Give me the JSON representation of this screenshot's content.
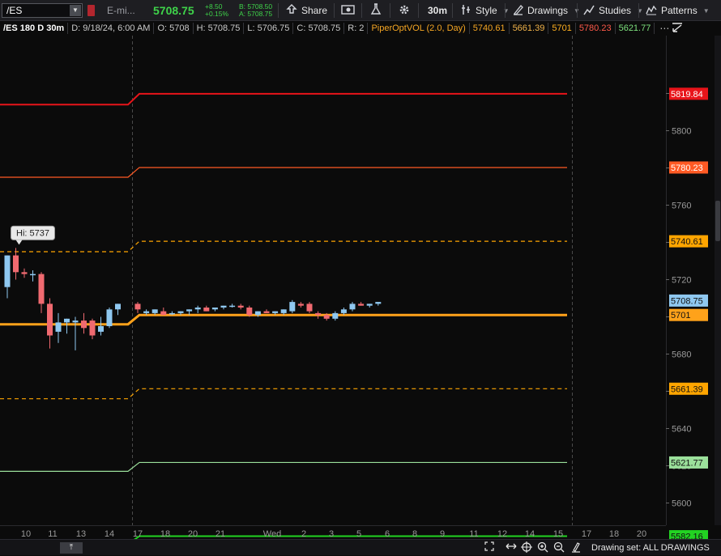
{
  "toolbar": {
    "symbol": "/ES",
    "instrument": "E-mi...",
    "last_price": "5708.75",
    "net_change": "+8.50",
    "net_change_pct": "+0.15%",
    "bid": "B: 5708.50",
    "ask": "A: 5708.75",
    "share_label": "Share",
    "timeframe_label": "30m",
    "style_label": "Style",
    "drawings_label": "Drawings",
    "studies_label": "Studies",
    "patterns_label": "Patterns",
    "icons": [
      "share-icon",
      "snapshot-icon",
      "flask-icon",
      "gear-icon",
      "style-icon",
      "drawings-icon",
      "studies-icon",
      "patterns-icon"
    ]
  },
  "header": {
    "title": "/ES 180 D 30m",
    "date": "D: 9/18/24, 6:00 AM",
    "open": "O: 5708",
    "high": "H: 5708.75",
    "low": "L: 5706.75",
    "close": "C: 5708.75",
    "range": "R: 2",
    "study_name": "PiperOptVOL (2.0, Day)",
    "study_values": [
      "5740.61",
      "5661.39",
      "5701",
      "5780.23",
      "5621.77"
    ],
    "menu_glyph": "⋯"
  },
  "chart_data": {
    "type": "candlestick",
    "y_range": [
      5570,
      5830
    ],
    "y_ticks": [
      5580,
      5600,
      5620,
      5640,
      5660,
      5680,
      5700,
      5720,
      5740,
      5760,
      5780,
      5800,
      5820
    ],
    "x_labels": [
      "10",
      "11",
      "13",
      "14",
      "17",
      "18",
      "20",
      "21",
      "Wed",
      "2",
      "3",
      "5",
      "6",
      "8",
      "9",
      "11",
      "12",
      "14",
      "15",
      "17",
      "18",
      "20"
    ],
    "session_divider_label": "17",
    "high_annotation": "Hi: 5737",
    "levels": [
      {
        "name": "upper-band-2",
        "color": "#e8141a",
        "style": "solid",
        "prev": 5814,
        "current": 5819.84,
        "label": "5819.84"
      },
      {
        "name": "upper-band-1",
        "color": "#ff5a24",
        "style": "solid",
        "prev": 5775,
        "current": 5780.23,
        "label": "5780.23"
      },
      {
        "name": "upper-dashed",
        "color": "#ffa500",
        "style": "dashed",
        "prev": 5735,
        "current": 5740.61,
        "label": "5740.61"
      },
      {
        "name": "mid-line",
        "color": "#ffa21a",
        "style": "thick",
        "prev": 5696,
        "current": 5701,
        "label": "5701"
      },
      {
        "name": "lower-dashed",
        "color": "#ffa500",
        "style": "dashed",
        "prev": 5656,
        "current": 5661.39,
        "label": "5661.39"
      },
      {
        "name": "lower-band-1",
        "color": "#9be09b",
        "style": "solid",
        "prev": 5617,
        "current": 5621.77,
        "label": "5621.77"
      },
      {
        "name": "lower-band-2",
        "color": "#22d322",
        "style": "solid",
        "prev": 5578,
        "current": 5582.16,
        "label": "5582.16"
      }
    ],
    "last_price_label": "5708.75",
    "candles": [
      {
        "o": 5716,
        "h": 5726,
        "l": 5710,
        "c": 5733
      },
      {
        "o": 5733,
        "h": 5737,
        "l": 5720,
        "c": 5724
      },
      {
        "o": 5724,
        "h": 5726,
        "l": 5721,
        "c": 5723
      },
      {
        "o": 5723,
        "h": 5725,
        "l": 5719,
        "c": 5723
      },
      {
        "o": 5723,
        "h": 5724,
        "l": 5702,
        "c": 5707
      },
      {
        "o": 5707,
        "h": 5710,
        "l": 5683,
        "c": 5690
      },
      {
        "o": 5692,
        "h": 5702,
        "l": 5686,
        "c": 5697
      },
      {
        "o": 5697,
        "h": 5699,
        "l": 5691,
        "c": 5699
      },
      {
        "o": 5697,
        "h": 5700,
        "l": 5682,
        "c": 5698
      },
      {
        "o": 5698,
        "h": 5702,
        "l": 5691,
        "c": 5694
      },
      {
        "o": 5698,
        "h": 5699,
        "l": 5688,
        "c": 5690
      },
      {
        "o": 5692,
        "h": 5700,
        "l": 5690,
        "c": 5695
      },
      {
        "o": 5695,
        "h": 5705,
        "l": 5694,
        "c": 5704
      },
      {
        "o": 5704,
        "h": 5707,
        "l": 5701,
        "c": 5707
      },
      {
        "o": 5707,
        "h": 5708,
        "l": 5702,
        "c": 5704
      },
      {
        "o": 5702,
        "h": 5704,
        "l": 5701,
        "c": 5703
      },
      {
        "o": 5702,
        "h": 5704,
        "l": 5701,
        "c": 5704
      },
      {
        "o": 5703,
        "h": 5705,
        "l": 5701,
        "c": 5701
      },
      {
        "o": 5702,
        "h": 5703,
        "l": 5701,
        "c": 5702
      },
      {
        "o": 5702,
        "h": 5703,
        "l": 5701,
        "c": 5703
      },
      {
        "o": 5703,
        "h": 5704,
        "l": 5701,
        "c": 5704
      },
      {
        "o": 5704,
        "h": 5706,
        "l": 5702,
        "c": 5705
      },
      {
        "o": 5705,
        "h": 5706,
        "l": 5703,
        "c": 5703
      },
      {
        "o": 5704,
        "h": 5705,
        "l": 5703,
        "c": 5705
      },
      {
        "o": 5705,
        "h": 5706,
        "l": 5704,
        "c": 5706
      },
      {
        "o": 5706,
        "h": 5707,
        "l": 5705,
        "c": 5706
      },
      {
        "o": 5706,
        "h": 5707,
        "l": 5704,
        "c": 5705
      },
      {
        "o": 5705,
        "h": 5706,
        "l": 5700,
        "c": 5701
      },
      {
        "o": 5701,
        "h": 5703,
        "l": 5700,
        "c": 5703
      },
      {
        "o": 5703,
        "h": 5704,
        "l": 5702,
        "c": 5702
      },
      {
        "o": 5702,
        "h": 5703,
        "l": 5701,
        "c": 5703
      },
      {
        "o": 5702,
        "h": 5704,
        "l": 5701,
        "c": 5704
      },
      {
        "o": 5703,
        "h": 5709,
        "l": 5702,
        "c": 5708
      },
      {
        "o": 5707,
        "h": 5708,
        "l": 5705,
        "c": 5706
      },
      {
        "o": 5707,
        "h": 5708,
        "l": 5702,
        "c": 5703
      },
      {
        "o": 5702,
        "h": 5703,
        "l": 5699,
        "c": 5701
      },
      {
        "o": 5701,
        "h": 5702,
        "l": 5698,
        "c": 5699
      },
      {
        "o": 5699,
        "h": 5703,
        "l": 5698,
        "c": 5702
      },
      {
        "o": 5702,
        "h": 5705,
        "l": 5701,
        "c": 5704
      },
      {
        "o": 5704,
        "h": 5708,
        "l": 5703,
        "c": 5707
      },
      {
        "o": 5707,
        "h": 5708,
        "l": 5706,
        "c": 5706
      },
      {
        "o": 5706,
        "h": 5707,
        "l": 5705,
        "c": 5707
      },
      {
        "o": 5707,
        "h": 5708,
        "l": 5706,
        "c": 5708
      }
    ]
  },
  "bottom_bar": {
    "scroll_glyph": "⤒",
    "drawing_set": "Drawing set: ALL DRAWINGS",
    "icons": [
      "expand-icon",
      "pan-icon",
      "zoom-in-icon",
      "zoom-out-icon",
      "crosshair-icon",
      "drawing-set-icon"
    ]
  },
  "colors": {
    "background": "#0b0b0b",
    "up_candle": "#8fc8f0",
    "down_candle": "#f06a70",
    "price_up_text": "#3fd34a",
    "grid_divider": "#4a4a4a"
  }
}
